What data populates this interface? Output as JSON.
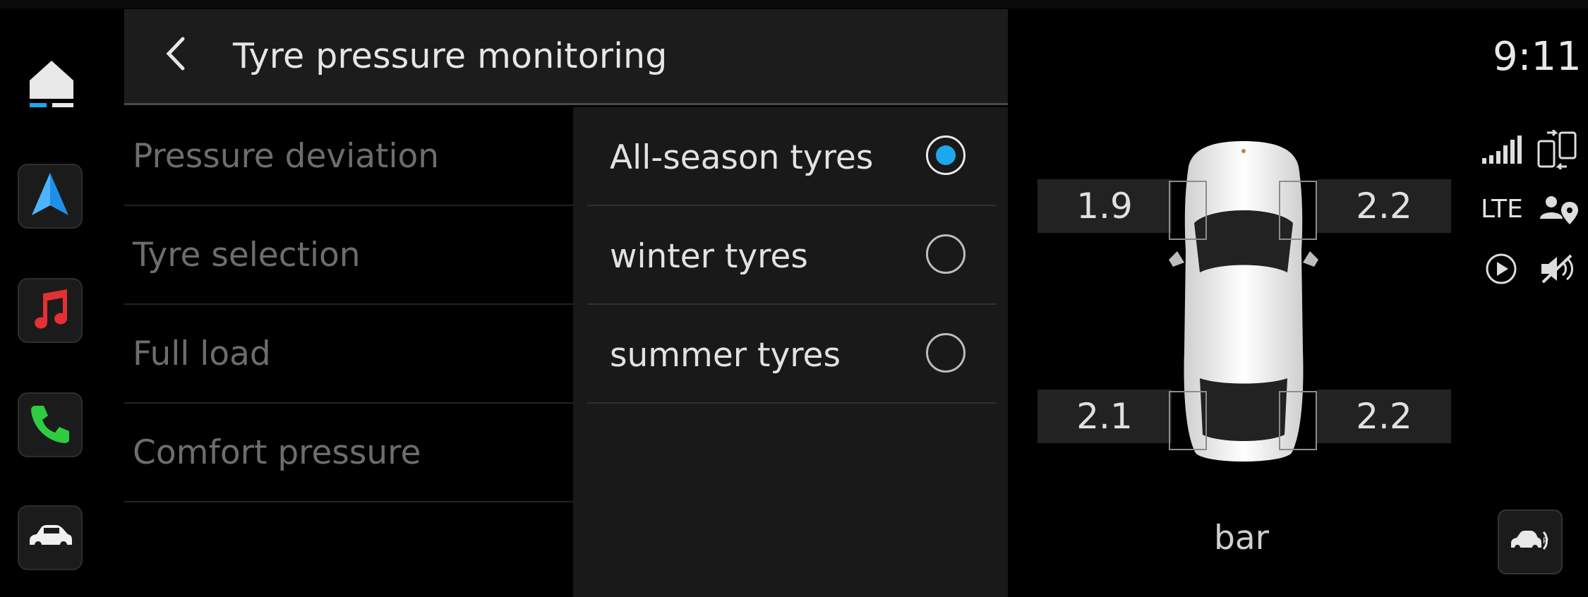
{
  "header": {
    "title": "Tyre pressure monitoring"
  },
  "menu": {
    "items": [
      {
        "label": "Pressure deviation"
      },
      {
        "label": "Tyre selection"
      },
      {
        "label": "Full load"
      },
      {
        "label": "Comfort pressure"
      }
    ]
  },
  "options": {
    "items": [
      {
        "label": "All-season tyres",
        "selected": true
      },
      {
        "label": "winter tyres",
        "selected": false
      },
      {
        "label": "summer tyres",
        "selected": false
      }
    ]
  },
  "tyres": {
    "front_left": "1.9",
    "front_right": "2.2",
    "rear_left": "2.1",
    "rear_right": "2.2",
    "unit": "bar"
  },
  "status": {
    "time": "9:11",
    "network": "LTE"
  },
  "rail": {
    "icons": [
      "home-icon",
      "navigation-icon",
      "music-icon",
      "phone-icon",
      "car-icon"
    ]
  },
  "colors": {
    "accent": "#1aa8ee",
    "background": "#000000",
    "panel": "#191919"
  }
}
